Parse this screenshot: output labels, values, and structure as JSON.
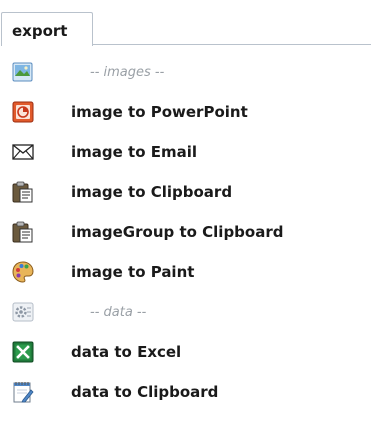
{
  "tab": {
    "label": "export"
  },
  "menu": {
    "images_header": "-- images --",
    "image_to_powerpoint": "image to PowerPoint",
    "image_to_email": "image to Email",
    "image_to_clipboard": "image to Clipboard",
    "imagegroup_to_clipboard": "imageGroup to Clipboard",
    "image_to_paint": "image to Paint",
    "data_header": "-- data --",
    "data_to_excel": "data to Excel",
    "data_to_clipboard": "data to Clipboard"
  },
  "icons": {
    "images_section": "picture-icon",
    "powerpoint": "powerpoint-icon",
    "email": "envelope-icon",
    "clipboard": "clipboard-icon",
    "clipboard_group": "clipboard-icon",
    "paint": "palette-icon",
    "data_section": "gear-icon",
    "excel": "excel-icon",
    "data_clipboard": "notepad-icon"
  },
  "colors": {
    "tab_border": "#b9c2cc",
    "text": "#1a1a1a",
    "section_text": "#9aa0a6",
    "powerpoint": "#d24726",
    "excel": "#1f7a3a"
  }
}
